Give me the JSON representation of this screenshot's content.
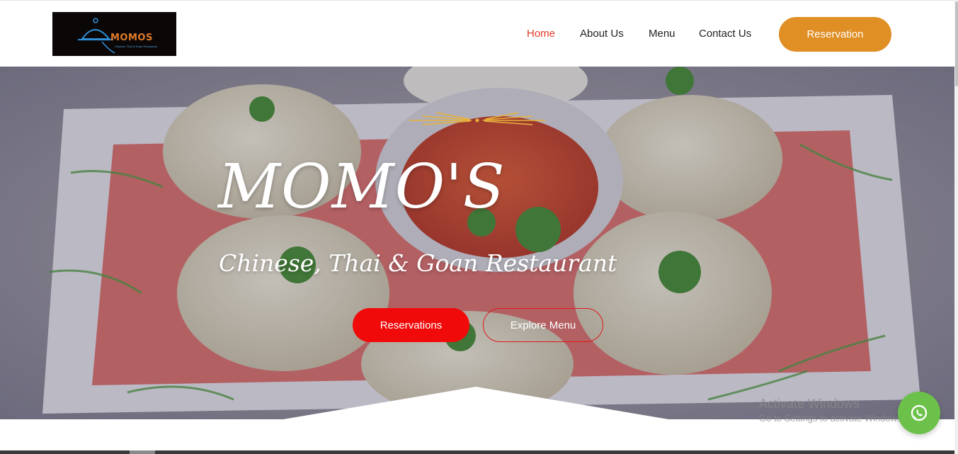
{
  "logo": {
    "text": "MOMOS",
    "subtext": "Chinese, Thai & Goan Restaurant"
  },
  "nav": {
    "items": [
      {
        "label": "Home",
        "active": true
      },
      {
        "label": "About Us",
        "active": false
      },
      {
        "label": "Menu",
        "active": false
      },
      {
        "label": "Contact Us",
        "active": false
      }
    ],
    "reservation_label": "Reservation"
  },
  "hero": {
    "title": "MOMO'S",
    "subtitle": "Chinese, Thai & Goan Restaurant",
    "reservations_label": "Reservations",
    "explore_label": "Explore Menu"
  },
  "watermark": {
    "title": "Activate Windows",
    "subtitle": "Go to Settings to activate Windows."
  },
  "icons": {
    "whatsapp": "whatsapp-icon"
  },
  "colors": {
    "accent_orange": "#df8f24",
    "nav_active": "#e03a2a",
    "cta_red": "#f00a0a",
    "whatsapp_green": "#6cc14a"
  }
}
